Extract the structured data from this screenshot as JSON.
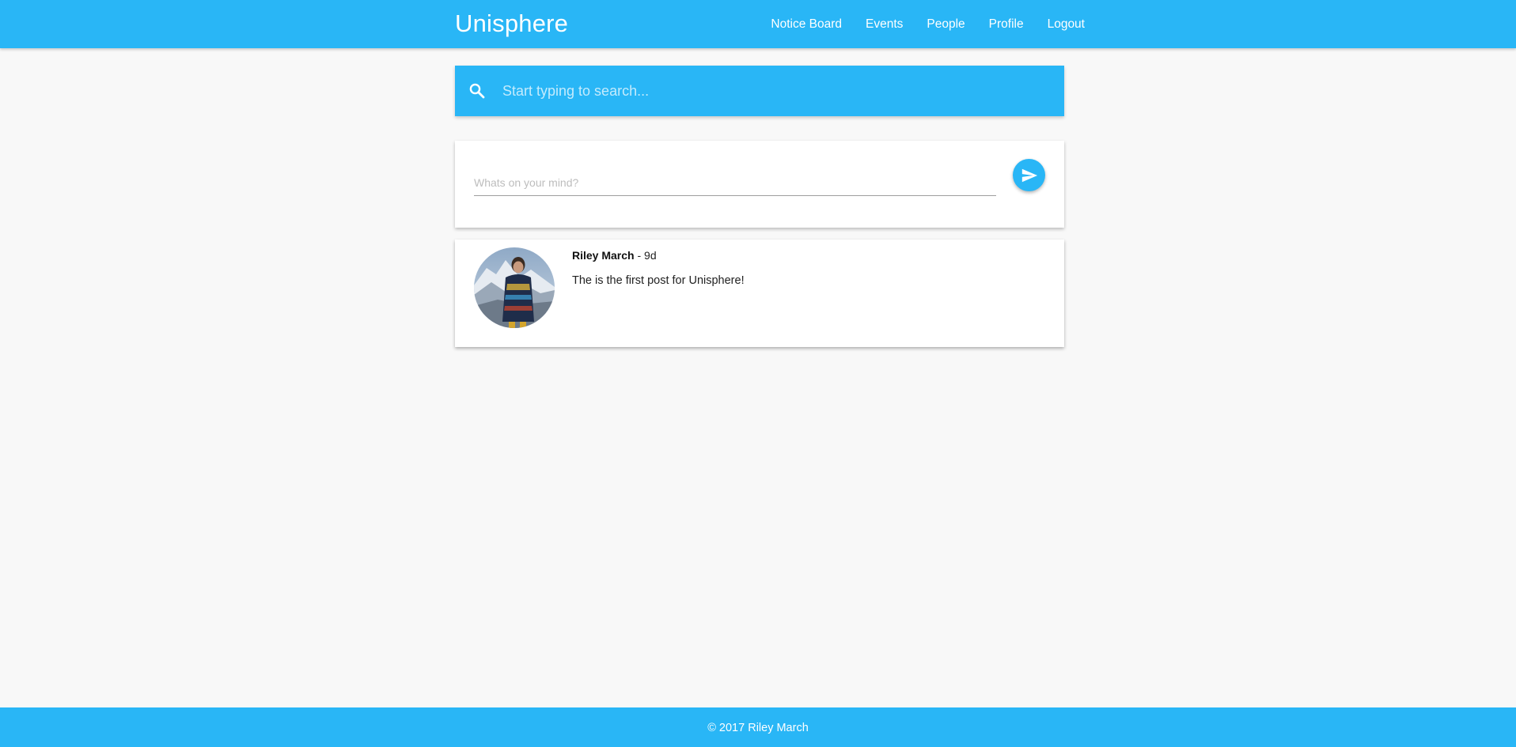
{
  "header": {
    "brand": "Unisphere",
    "nav": [
      {
        "label": "Notice Board"
      },
      {
        "label": "Events"
      },
      {
        "label": "People"
      },
      {
        "label": "Profile"
      },
      {
        "label": "Logout"
      }
    ]
  },
  "search": {
    "placeholder": "Start typing to search...",
    "value": "",
    "icon": "search-icon"
  },
  "composer": {
    "placeholder": "Whats on your mind?",
    "value": "",
    "send_icon": "send-icon"
  },
  "posts": [
    {
      "author": "Riley March",
      "separator": " - ",
      "age": "9d",
      "text": "The is the first post for Unisphere!"
    }
  ],
  "footer": {
    "text": "© 2017 Riley March"
  },
  "colors": {
    "primary": "#29b6f6",
    "background": "#f8f8f8",
    "card": "#ffffff"
  }
}
